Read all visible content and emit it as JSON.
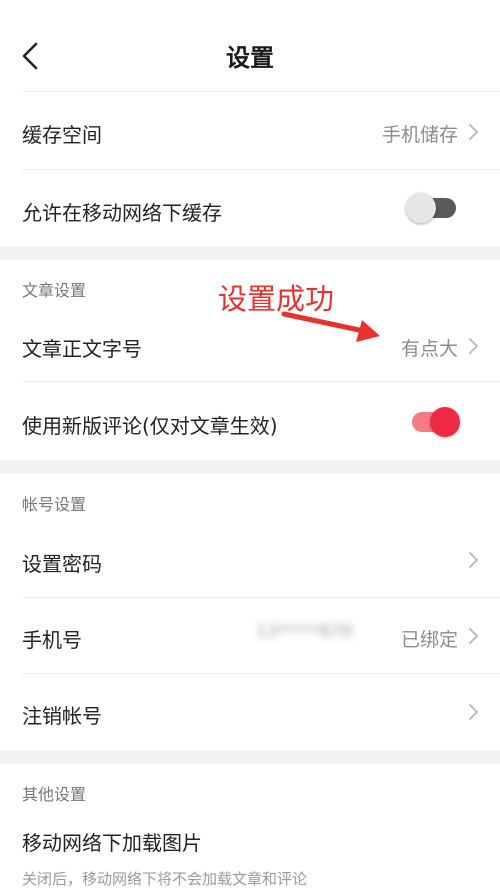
{
  "header": {
    "title": "设置",
    "back_icon": "chevron-left-icon"
  },
  "storage": {
    "cache_space": {
      "label": "缓存空间",
      "value": "手机储存"
    },
    "allow_mobile_cache": {
      "label": "允许在移动网络下缓存",
      "toggle_on": false
    }
  },
  "article_settings": {
    "section_title": "文章设置",
    "font_size": {
      "label": "文章正文字号",
      "value": "有点大"
    },
    "new_comments": {
      "label": "使用新版评论(仅对文章生效)",
      "toggle_on": true
    }
  },
  "annotation": {
    "text": "设置成功",
    "color": "#e8322d"
  },
  "account_settings": {
    "section_title": "帐号设置",
    "set_password": {
      "label": "设置密码"
    },
    "phone": {
      "label": "手机号",
      "masked_value": "13*****670",
      "status": "已绑定"
    },
    "cancel_account": {
      "label": "注销帐号"
    }
  },
  "other_settings": {
    "section_title": "其他设置",
    "load_images": {
      "label": "移动网络下加载图片",
      "description": "关闭后，移动网络下将不会加载文章和评论"
    }
  },
  "colors": {
    "accent": "#ee2a45",
    "toggle_on_track": "#f37b86",
    "toggle_off_track": "#5a5a5a",
    "section_gap": "#f2f2f2"
  }
}
